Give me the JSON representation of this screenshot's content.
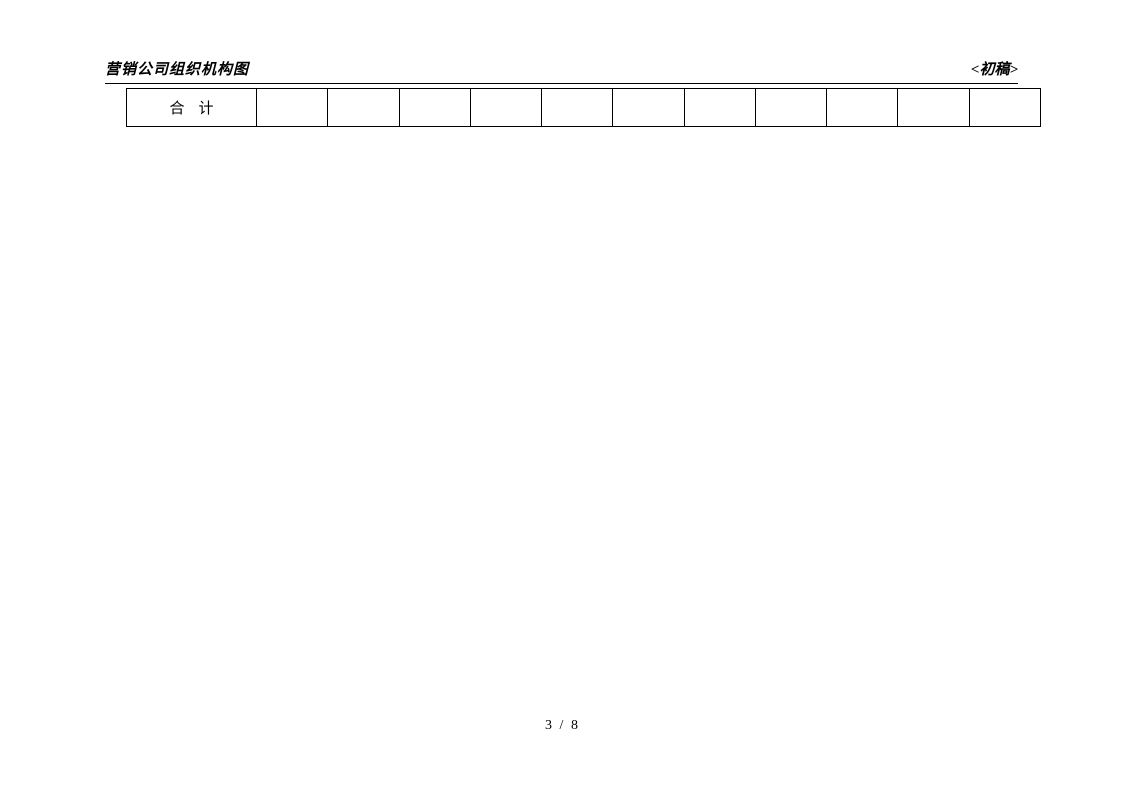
{
  "header": {
    "left": "营销公司组织机构图",
    "right": "<初稿>"
  },
  "table": {
    "row_label": "合计",
    "cells": [
      "",
      "",
      "",
      "",
      "",
      "",
      "",
      "",
      "",
      "",
      ""
    ]
  },
  "footer": {
    "page_current": "3",
    "page_sep": "/",
    "page_total": "8"
  }
}
